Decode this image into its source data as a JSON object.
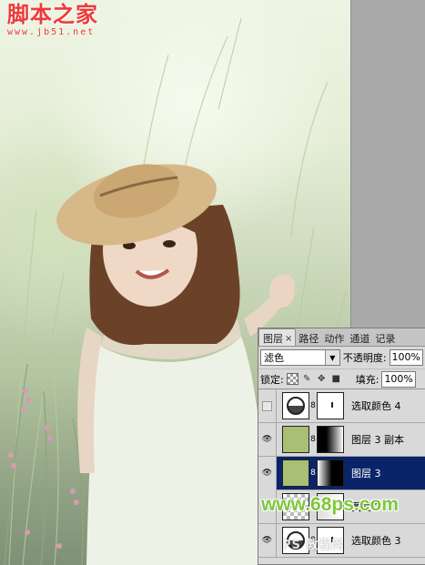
{
  "watermark_top": {
    "title": "脚本之家",
    "url": "www.jb51.net"
  },
  "watermark_bottom": {
    "site": "www.68ps.com",
    "faint": "PS 教程网"
  },
  "layers_panel": {
    "tabs": [
      {
        "label": "图层",
        "active": true
      },
      {
        "label": "路径"
      },
      {
        "label": "动作"
      },
      {
        "label": "通道"
      },
      {
        "label": "记录"
      }
    ],
    "blend_mode": "滤色",
    "opacity_label": "不透明度:",
    "opacity_value": "100%",
    "lock_label": "锁定:",
    "fill_label": "填充:",
    "fill_value": "100%",
    "layers": [
      {
        "name": "选取颜色 4",
        "visible": false,
        "selected": false,
        "thumb": "adjustment",
        "mask": "white"
      },
      {
        "name": "图层 3 副本",
        "visible": true,
        "selected": false,
        "thumb": "green",
        "mask": "gradient-black-white"
      },
      {
        "name": "图层 3",
        "visible": true,
        "selected": true,
        "thumb": "green",
        "mask": "gradient-white-black"
      },
      {
        "name": "图层 2",
        "visible": true,
        "selected": false,
        "thumb": "checker",
        "mask": "gradient-light"
      },
      {
        "name": "选取颜色 3",
        "visible": true,
        "selected": false,
        "thumb": "adjustment",
        "mask": "white"
      }
    ]
  },
  "colors": {
    "watermark_red": "#ee3a3a",
    "watermark_green": "#7ec73b",
    "selection_blue": "#0a246a",
    "layer_fill_green": "#a8bf74"
  }
}
